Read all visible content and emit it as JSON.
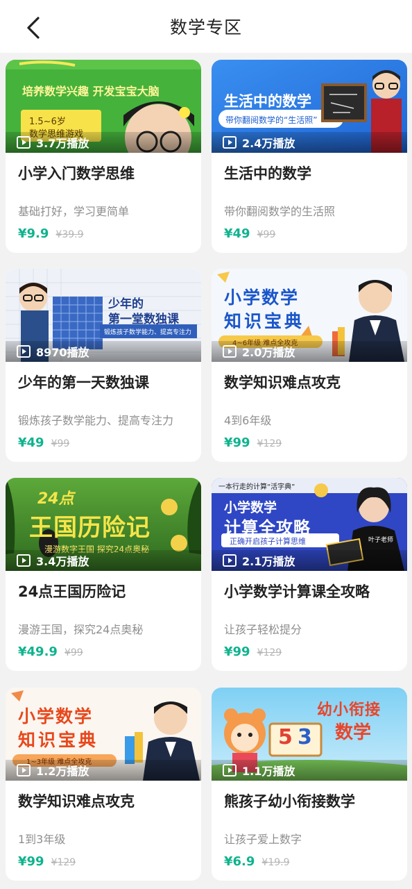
{
  "header": {
    "title": "数学专区"
  },
  "courses": [
    {
      "banner_title": "培养数学兴趣  开发宝宝大脑",
      "banner_sub": "1.5~6岁",
      "banner_sub2": "数学思维游戏",
      "plays": "3.7万播放",
      "title": "小学入门数学思维",
      "subtitle": "基础打好，学习更简单",
      "price": "¥9.9",
      "original_price": "¥39.9",
      "theme_color": "#3fae3a"
    },
    {
      "banner_title": "生活中的数学",
      "banner_sub": "带你翻阅数学的“生活照”",
      "plays": "2.4万播放",
      "title": "生活中的数学",
      "subtitle": "带你翻阅数学的生活照",
      "price": "¥49",
      "original_price": "¥99",
      "theme_color": "#2e7be6"
    },
    {
      "banner_title": "少年的",
      "banner_title2": "第一堂数独课",
      "banner_sub": "锻炼孩子数学能力、提高专注力",
      "plays": "8970播放",
      "title": "少年的第一天数独课",
      "subtitle": "锻炼孩子数学能力、提高专注力",
      "price": "¥49",
      "original_price": "¥99",
      "theme_color": "#e8eef8"
    },
    {
      "banner_title": "小学数学",
      "banner_title2": "知识宝典",
      "banner_sub": "4~6年级 难点全攻克",
      "plays": "2.0万播放",
      "title": "数学知识难点攻克",
      "subtitle": "4到6年级",
      "price": "¥99",
      "original_price": "¥129",
      "theme_color": "#1a56c9"
    },
    {
      "banner_title": "24点",
      "banner_title2": "王国历险记",
      "banner_sub": "漫游数字王国 探究24点奥秘",
      "plays": "3.4万播放",
      "title": "24点王国历险记",
      "subtitle": "漫游王国，探究24点奥秘",
      "price": "¥49.9",
      "original_price": "¥99",
      "theme_color": "#3f8a2a"
    },
    {
      "banner_top": "一本行走的计算“活字典”",
      "banner_title": "小学数学",
      "banner_title2": "计算全攻略",
      "banner_sub": "正确开启孩子计算思维",
      "banner_tag": "叶子老师",
      "plays": "2.1万播放",
      "title": "小学数学计算课全攻略",
      "subtitle": "让孩子轻松提分",
      "price": "¥99",
      "original_price": "¥129",
      "theme_color": "#2f47c4"
    },
    {
      "banner_title": "小学数学",
      "banner_title2": "知识宝典",
      "banner_sub": "1~3年级 难点全攻克",
      "plays": "1.2万播放",
      "title": "数学知识难点攻克",
      "subtitle": "1到3年级",
      "price": "¥99",
      "original_price": "¥129",
      "theme_color": "#e8481c"
    },
    {
      "banner_title": "幼小衔接",
      "banner_title2": "数学",
      "banner_sub": "5",
      "banner_sub2": "3",
      "plays": "1.1万播放",
      "title": "熊孩子幼小衔接数学",
      "subtitle": "让孩子爱上数字",
      "price": "¥6.9",
      "original_price": "¥19.9",
      "theme_color": "#6cc2ee"
    }
  ]
}
